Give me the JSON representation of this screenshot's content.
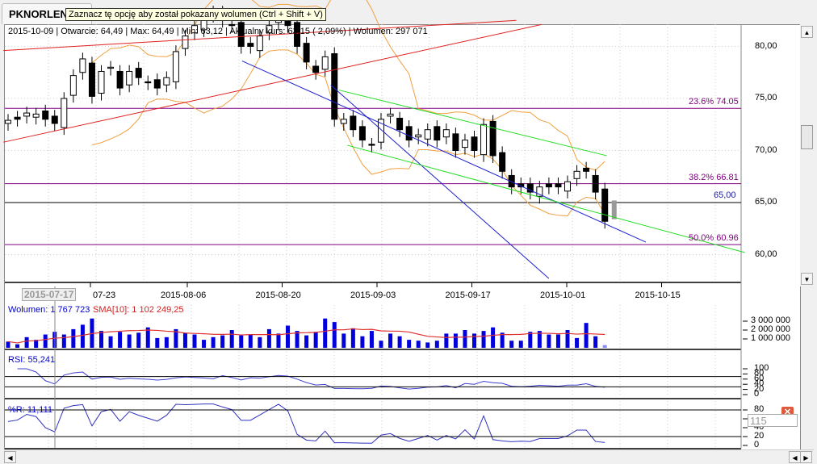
{
  "tab": {
    "title": "PKNORLEN"
  },
  "tooltip": "Zaznacz tę opcję aby został pokazany wolumen (Ctrl + Shift + V)",
  "info": "2015-10-09 | Otwarcie: 64,49 | Max: 64,49 | Min: 63,12 | Aktualny kurs: 63,15 ( 2,09%)  | Wolumen: 297 071",
  "price_axis": [
    "80,00",
    "75,00",
    "70,00",
    "65,00",
    "60,00"
  ],
  "fib": [
    {
      "label": "23.6% 74.05",
      "value": 74.05
    },
    {
      "label": "38.2% 66.81",
      "value": 66.81
    },
    {
      "label": "50.0% 60.96",
      "value": 60.96
    }
  ],
  "level": {
    "label": "65,00",
    "value": 65
  },
  "dates": {
    "cursor": "2015-07-17",
    "ticks": [
      "07-23",
      "2015-08-06",
      "2015-08-20",
      "2015-09-03",
      "2015-09-17",
      "2015-10-01",
      "2015-10-15"
    ]
  },
  "volume": {
    "label": "Wolumen: 1 767 723",
    "sma_label": "SMA[10]: 1 102 249,25",
    "axis": [
      "3 000 000",
      "2 000 000",
      "1 000 000"
    ]
  },
  "rsi": {
    "label": "RSI: 55,241",
    "axis": [
      "100",
      "80",
      "60",
      "40",
      "20",
      "0"
    ]
  },
  "wr": {
    "label": "%R: 11,111",
    "axis": [
      "80",
      "60",
      "40",
      "20",
      "0"
    ],
    "box": "115"
  },
  "colors": {
    "up": "#ffffff",
    "down": "#000000",
    "bb": "#f0a040",
    "vol": "#0000dd",
    "sma": "#e03030",
    "fib": "#800080",
    "green": "#22dd22",
    "blue": "#2020d0",
    "red": "#e02020"
  },
  "chart_data": {
    "type": "candlestick",
    "closes": [
      72.9,
      73,
      73.6,
      73.5,
      73,
      72.6,
      75,
      77.2,
      78.8,
      75.2,
      77.6,
      78,
      76,
      77.6,
      77,
      76.5,
      76,
      77,
      79.5,
      81,
      82,
      83,
      83,
      82.5,
      82,
      80,
      80,
      81,
      82,
      83,
      82,
      80,
      78.5,
      77.5,
      79,
      73,
      73,
      72,
      71,
      70.5,
      73,
      73.5,
      72,
      71,
      71.5,
      72,
      71,
      72,
      70,
      71,
      70,
      72.5,
      69.5,
      68,
      66.5,
      66.5,
      66,
      66.5,
      66.5,
      66.5,
      67,
      68,
      68,
      66,
      63.2
    ],
    "volumes_m": [
      0.7,
      0.4,
      1.2,
      0.9,
      1.5,
      1.8,
      1.5,
      2.1,
      2.6,
      3.3,
      1.9,
      1.3,
      1.8,
      1.5,
      1.7,
      2.3,
      1.1,
      1.2,
      2.1,
      1.7,
      1.5,
      0.9,
      1.2,
      1.4,
      2,
      1.4,
      1.5,
      1.2,
      2.1,
      1.6,
      2.5,
      1.9,
      1.4,
      1.8,
      3.3,
      2.9,
      1.6,
      2.2,
      1.3,
      1.9,
      0.8,
      1.6,
      1.3,
      0.9,
      0.8,
      0.6,
      0.8,
      1.6,
      1.6,
      2,
      1.6,
      1.9,
      2.3,
      1.7,
      0.8,
      0.8,
      1.8,
      1.9,
      1.5,
      1.5,
      2,
      1.1,
      2.8,
      1.3,
      0.3
    ],
    "lines": [
      {
        "color": "red",
        "a": [
          -0.5,
          70.8
        ],
        "b": [
          57.2,
          82.1
        ]
      },
      {
        "color": "red",
        "a": [
          -0.5,
          79.6
        ],
        "b": [
          54.5,
          82.5
        ]
      },
      {
        "color": "blue",
        "a": [
          25.1,
          78.6
        ],
        "b": [
          68.4,
          61.2
        ]
      },
      {
        "color": "blue",
        "a": [
          34.6,
          76.3
        ],
        "b": [
          58,
          57.7
        ]
      },
      {
        "color": "green",
        "a": [
          35.5,
          75.8
        ],
        "b": [
          64.2,
          69.5
        ]
      },
      {
        "color": "green",
        "a": [
          36.4,
          70.5
        ],
        "b": [
          79,
          60.2
        ]
      }
    ]
  }
}
